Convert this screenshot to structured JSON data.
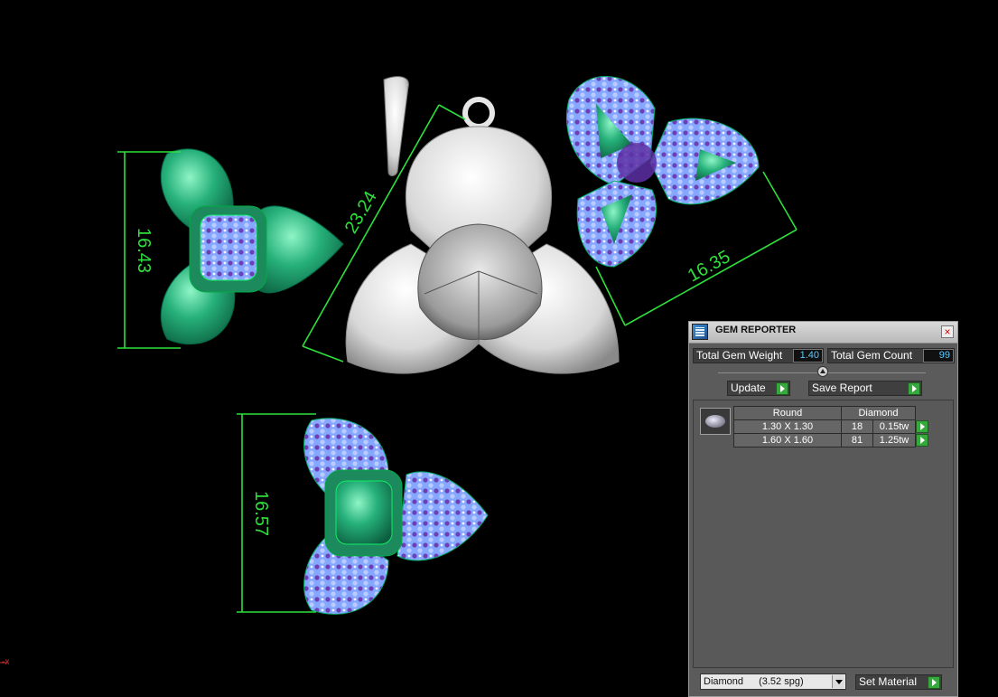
{
  "viewport": {
    "dimensions": [
      "16.43",
      "23.24",
      "16.35",
      "16.57"
    ],
    "axis_marker": "-x"
  },
  "gem_reporter": {
    "title": "GEM REPORTER",
    "close_glyph": "×",
    "total_gem_weight_label": "Total Gem Weight",
    "total_gem_weight_value": "1.40",
    "total_gem_count_label": "Total Gem Count",
    "total_gem_count_value": "99",
    "update_label": "Update",
    "save_report_label": "Save Report",
    "table": {
      "headers": [
        "Round",
        "Diamond"
      ],
      "rows": [
        {
          "size": "1.30 X 1.30",
          "count": "18",
          "weight": "0.15tw"
        },
        {
          "size": "1.60 X 1.60",
          "count": "81",
          "weight": "1.25tw"
        }
      ]
    },
    "material_select": {
      "name": "Diamond",
      "spg": "(3.52 spg)"
    },
    "set_material_label": "Set Material"
  },
  "colors": {
    "dimension_green": "#2ee03c",
    "gem_blue": "#7fa6ff",
    "metal_green": "#1e9a6a",
    "accent_value": "#59c8ff"
  }
}
